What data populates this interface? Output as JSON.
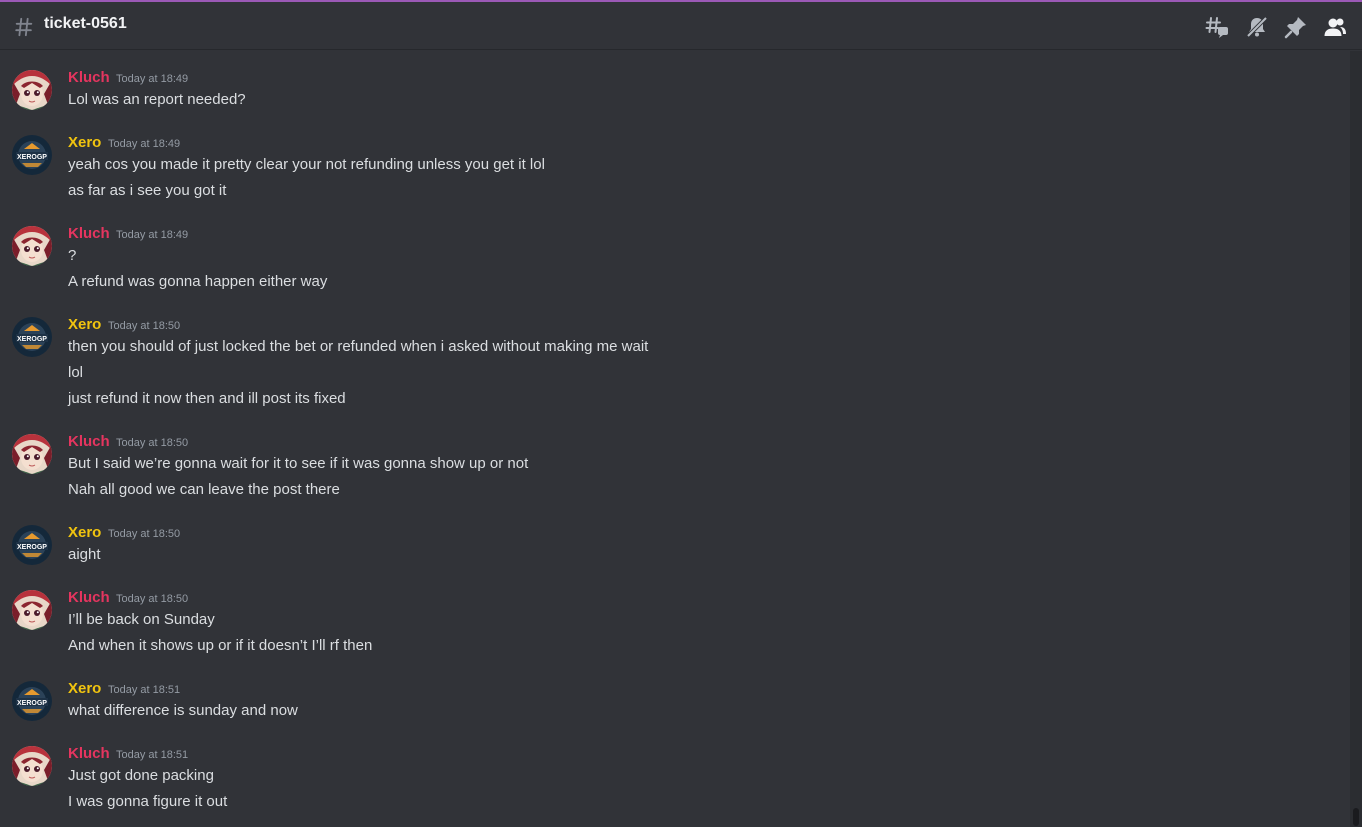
{
  "channel": {
    "name": "ticket-0561"
  },
  "header_icons": [
    "threads-icon",
    "mute-bell-icon",
    "pin-icon",
    "members-icon"
  ],
  "users": {
    "kluch": {
      "name": "Kluch",
      "color": "#e5355f"
    },
    "xero": {
      "name": "Xero",
      "color": "#f1c40f"
    }
  },
  "messages": [
    {
      "author": "Kluch",
      "timestamp": "Today at 18:49",
      "lines": [
        "Lol was an report needed?"
      ]
    },
    {
      "author": "Xero",
      "timestamp": "Today at 18:49",
      "lines": [
        "yeah cos you made it pretty clear your not refunding unless you get it lol",
        "as far as i see you got it"
      ]
    },
    {
      "author": "Kluch",
      "timestamp": "Today at 18:49",
      "lines": [
        "?",
        "A refund was gonna happen either way"
      ]
    },
    {
      "author": "Xero",
      "timestamp": "Today at 18:50",
      "lines": [
        "then you should of just locked the bet or refunded when i asked without making me wait",
        "lol",
        "just refund it now then and ill post its fixed"
      ]
    },
    {
      "author": "Kluch",
      "timestamp": "Today at 18:50",
      "lines": [
        "But I said we’re gonna wait for it to see if it was gonna show up or not",
        "Nah all good we can leave the post there"
      ]
    },
    {
      "author": "Xero",
      "timestamp": "Today at 18:50",
      "lines": [
        "aight"
      ]
    },
    {
      "author": "Kluch",
      "timestamp": "Today at 18:50",
      "lines": [
        "I’ll be back on Sunday",
        "And when it shows up or if it doesn’t I’ll rf then"
      ]
    },
    {
      "author": "Xero",
      "timestamp": "Today at 18:51",
      "lines": [
        "what difference is sunday and now"
      ]
    },
    {
      "author": "Kluch",
      "timestamp": "Today at 18:51",
      "lines": [
        "Just got done packing",
        "I was gonna figure it out"
      ]
    }
  ],
  "avatar_text": {
    "xero": "XEROGP"
  }
}
